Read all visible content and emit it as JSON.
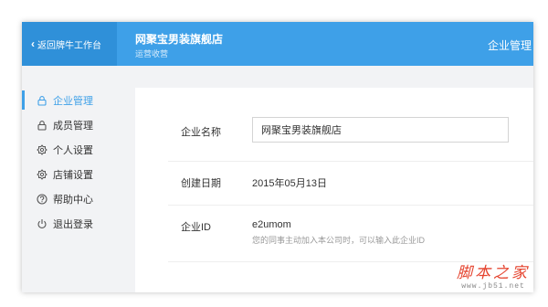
{
  "header": {
    "back_label": "返回牌牛工作台",
    "store_name": "网聚宝男装旗舰店",
    "store_sub": "运营收营",
    "section_title": "企业管理"
  },
  "sidebar": {
    "items": [
      {
        "label": "企业管理",
        "icon": "lock-icon",
        "active": true
      },
      {
        "label": "成员管理",
        "icon": "lock-icon"
      },
      {
        "label": "个人设置",
        "icon": "gear-icon"
      },
      {
        "label": "店铺设置",
        "icon": "gear-icon"
      },
      {
        "label": "帮助中心",
        "icon": "help-icon"
      },
      {
        "label": "退出登录",
        "icon": "power-icon"
      }
    ]
  },
  "form": {
    "name_label": "企业名称",
    "name_value": "网聚宝男装旗舰店",
    "date_label": "创建日期",
    "date_value": "2015年05月13日",
    "id_label": "企业ID",
    "id_value": "e2umom",
    "id_hint": "您的同事主动加入本公司时，可以输入此企业ID"
  },
  "watermark": {
    "title": "脚本之家",
    "url": "www.jb51.net"
  },
  "colors": {
    "primary": "#3ea0e8",
    "back_bg": "#2f90d9",
    "watermark": "#e5442f"
  }
}
